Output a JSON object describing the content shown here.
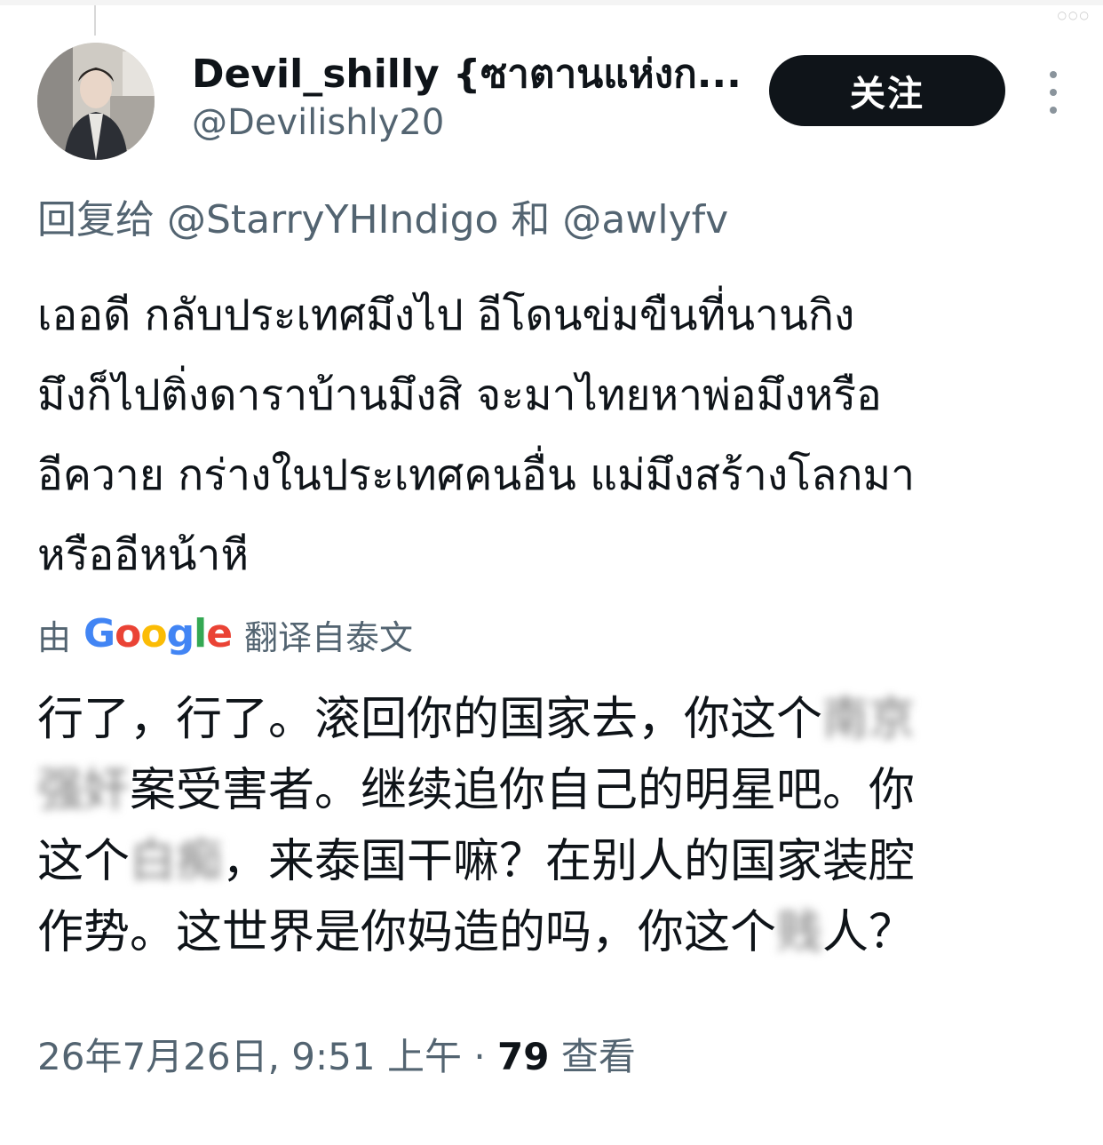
{
  "header": {
    "display_name": "Devil_shilly {ซาตานแห่งก...",
    "handle": "@Devilishly20",
    "follow_label": "关注",
    "more_icon": "more-vertical-icon"
  },
  "reply": {
    "prefix": "回复给",
    "mention_1": "@StarryYHIndigo",
    "conjunction": "和",
    "mention_2": "@awlyfv"
  },
  "thai_body": {
    "line_1": "เออดี กลับประเทศมึงไป อีโดนข่มขืนที่นานกิง",
    "line_2": "มึงก็ไปติ่งดาราบ้านมึงสิ จะมาไทยหาพ่อมึงหรือ",
    "line_3": "อีควาย กร่างในประเทศคนอื่น แม่มึงสร้างโลกมา",
    "line_4": "หรืออีหน้าหี"
  },
  "translation": {
    "by": "由",
    "google_letters": [
      "G",
      "o",
      "o",
      "g",
      "l",
      "e"
    ],
    "source": "翻译自泰文"
  },
  "zh_body": {
    "line_1_a": "行了，行了。滚回你的国家去，你这个",
    "line_1_blur": "南京",
    "line_2_blur": "强奸",
    "line_2_b": "案受害者。继续追你自己的明星吧。你",
    "line_3_a": "这个",
    "line_3_blur": "白痴",
    "line_3_b": "，来泰国干嘛？在别人的国家装腔",
    "line_4_a": "作势。这世界是你妈造的吗，你这个",
    "line_4_blur": "贱",
    "line_4_b": "人？"
  },
  "meta": {
    "timestamp": "26年7月26日, 9:51 上午 · ",
    "views_count": "79",
    "views_label": " 查看"
  },
  "colors": {
    "text_primary": "#0f1419",
    "text_secondary": "#536471",
    "button_bg": "#0f1419",
    "button_text": "#ffffff"
  }
}
